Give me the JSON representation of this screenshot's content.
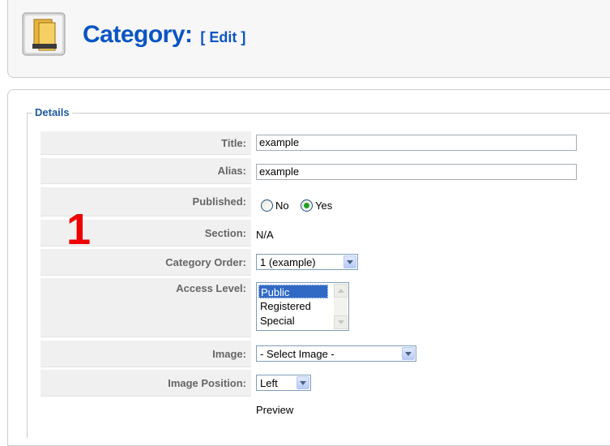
{
  "header": {
    "title": "Category:",
    "edit_label": "[ Edit ]",
    "icon": "category-folder-icon"
  },
  "fieldset": {
    "legend": "Details"
  },
  "form": {
    "title_label": "Title:",
    "title_value": "example",
    "alias_label": "Alias:",
    "alias_value": "example",
    "published_label": "Published:",
    "published_options": [
      "No",
      "Yes"
    ],
    "published_selected": "Yes",
    "section_label": "Section:",
    "section_value": "N/A",
    "order_label": "Category Order:",
    "order_value": "1 (example)",
    "access_label": "Access Level:",
    "access_options": [
      "Public",
      "Registered",
      "Special"
    ],
    "access_selected": "Public",
    "image_label": "Image:",
    "image_value": "- Select Image -",
    "image_position_label": "Image Position:",
    "image_position_value": "Left",
    "preview_label": "Preview"
  },
  "annotation": {
    "marker": "1",
    "color": "#ee0000"
  },
  "colors": {
    "title_blue": "#0b55c4",
    "legend_blue": "#1d5a9e",
    "label_gray": "#666666",
    "label_bg": "#f0f0f0"
  }
}
